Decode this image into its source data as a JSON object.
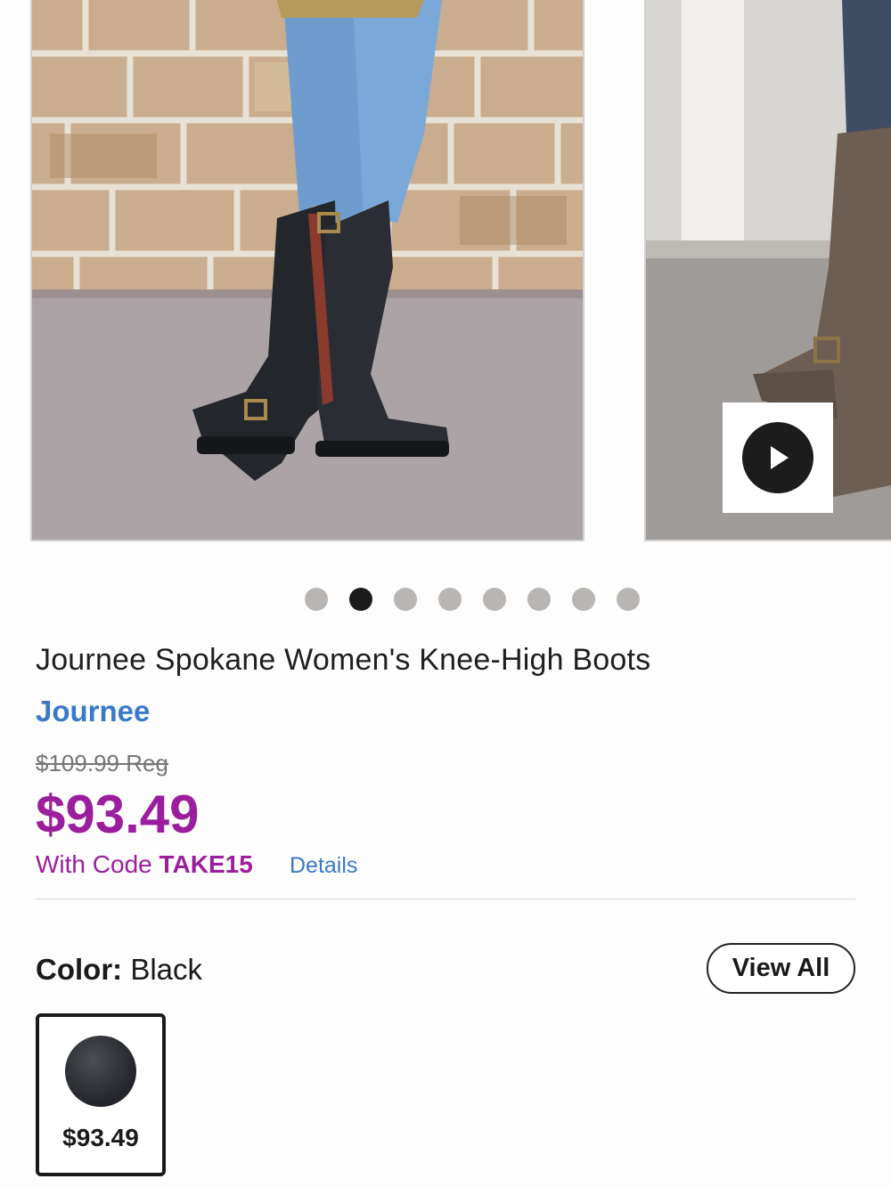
{
  "gallery": {
    "slides": [
      "slide-1",
      "slide-2"
    ],
    "active_dot": 1,
    "dot_count": 8
  },
  "product": {
    "title": "Journee Spokane Women's Knee-High Boots",
    "brand": "Journee",
    "reg_price": "$109.99 Reg",
    "sale_price": "$93.49",
    "code_prefix": "With Code ",
    "code": "TAKE15",
    "details_label": "Details"
  },
  "color": {
    "label": "Color:",
    "value": " Black",
    "view_all_label": "View All",
    "swatches": [
      {
        "price": "$93.49"
      }
    ]
  },
  "colors": {
    "sale": "#9b1f9c",
    "link": "#3a78c8"
  }
}
